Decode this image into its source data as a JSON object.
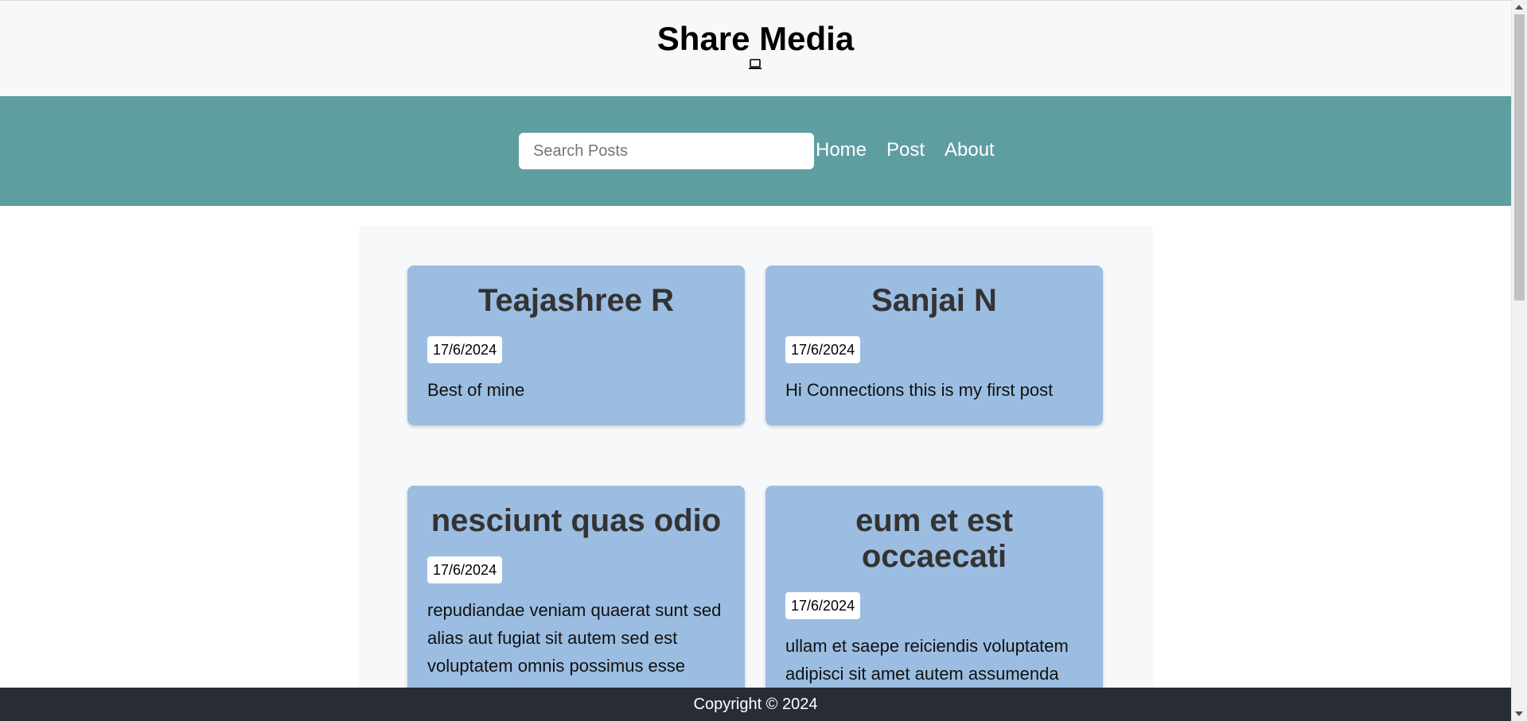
{
  "header": {
    "title": "Share Media",
    "icon": "laptop-icon"
  },
  "nav": {
    "search_placeholder": "Search Posts",
    "search_value": "",
    "links": [
      "Home",
      "Post",
      "About"
    ]
  },
  "posts": [
    {
      "title": "Teajashree R",
      "date": "17/6/2024",
      "body": "Best of mine"
    },
    {
      "title": "Sanjai N",
      "date": "17/6/2024",
      "body": "Hi Connections this is my first post"
    },
    {
      "title": "nesciunt quas odio",
      "date": "17/6/2024",
      "body": "repudiandae veniam quaerat sunt sed alias aut fugiat sit autem sed est voluptatem omnis possimus esse"
    },
    {
      "title": "eum et est occaecati",
      "date": "17/6/2024",
      "body": "ullam et saepe reiciendis voluptatem adipisci sit amet autem assumenda"
    }
  ],
  "footer": {
    "copyright": "Copyright © 2024"
  },
  "colors": {
    "navbar": "#5f9ea0",
    "card": "#9bbde1",
    "footer": "#282c34"
  }
}
